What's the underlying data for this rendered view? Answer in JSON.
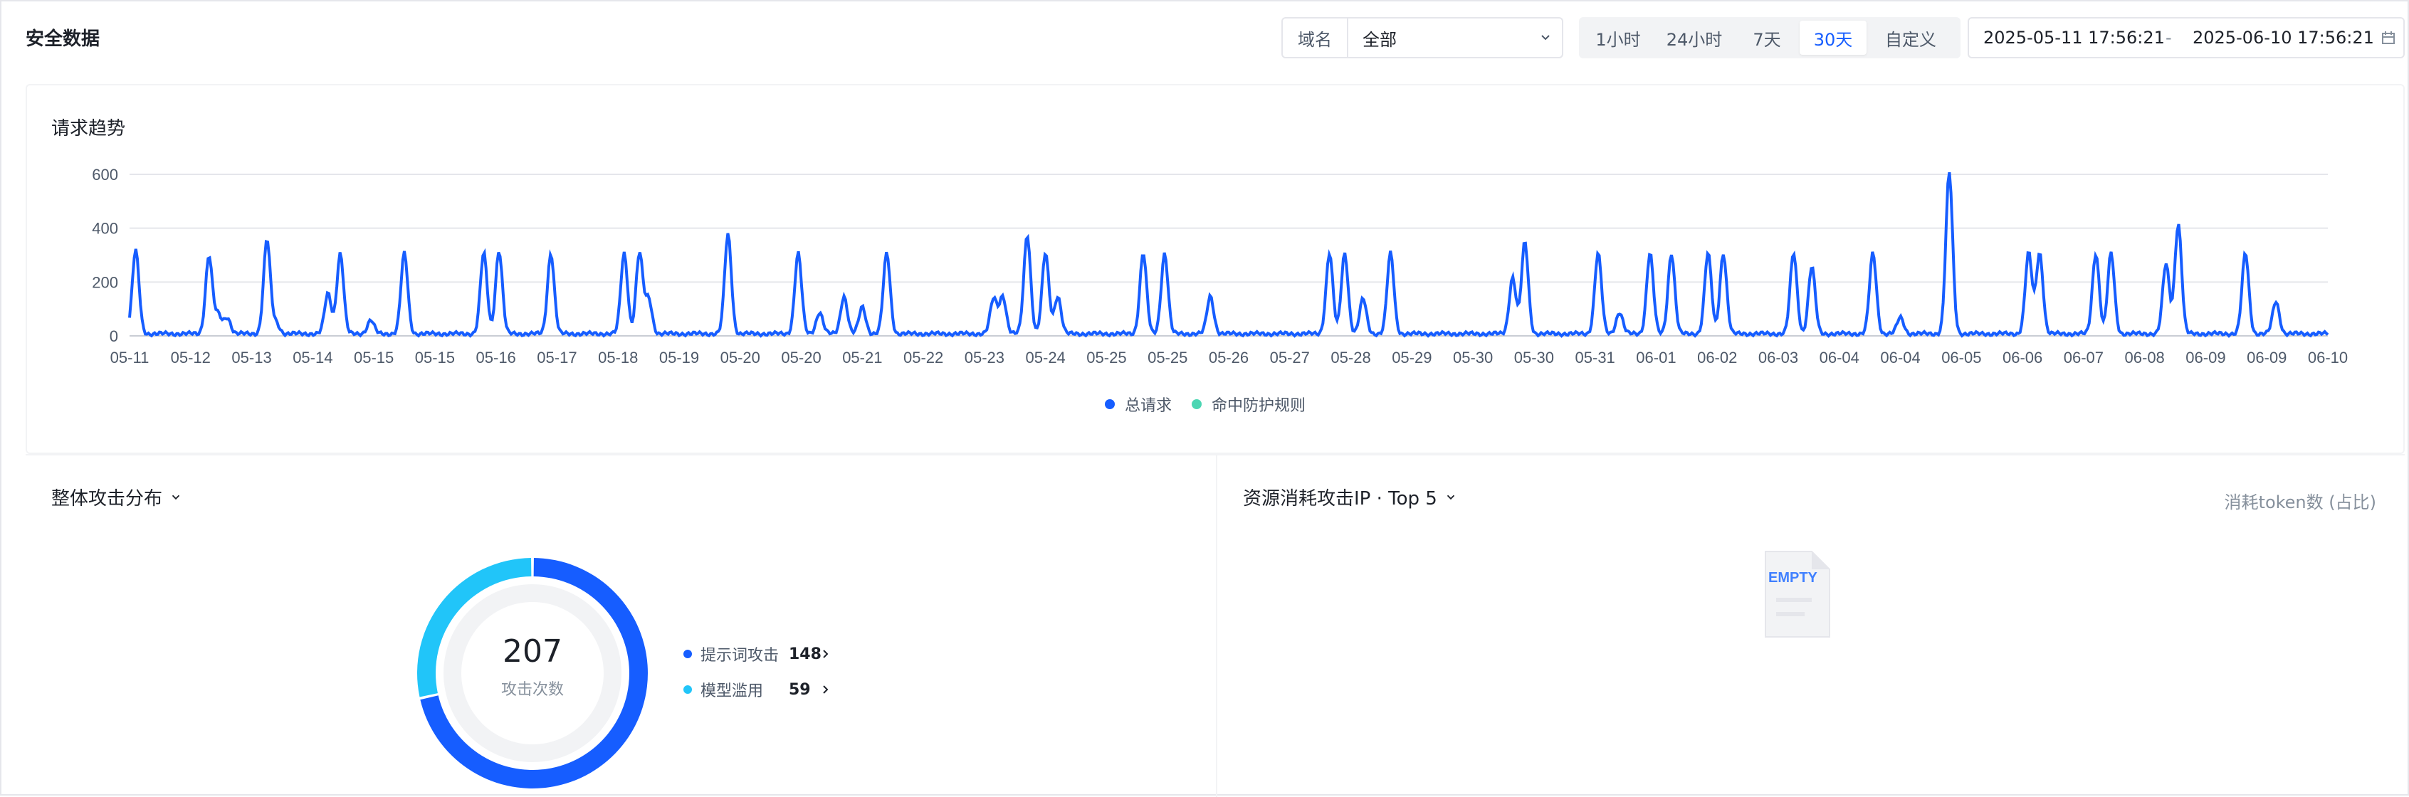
{
  "header": {
    "title": "安全数据",
    "domain_label": "域名",
    "domain_value": "全部",
    "time_options": [
      "1小时",
      "24小时",
      "7天",
      "30天",
      "自定义"
    ],
    "time_active": "30天",
    "range_start": "2025-05-11 17:56:21",
    "range_sep": "-",
    "range_end": "2025-06-10 17:56:21"
  },
  "trend": {
    "title": "请求趋势",
    "legend": [
      {
        "label": "总请求",
        "color": "#165dff"
      },
      {
        "label": "命中防护规则",
        "color": "#4cd6b3"
      }
    ]
  },
  "chart_data": {
    "type": "line",
    "ylim": [
      0,
      600
    ],
    "yticks": [
      0,
      200,
      400,
      600
    ],
    "grid": true,
    "legend_position": "bottom",
    "x_tick_labels": [
      "05-11",
      "05-12",
      "05-13",
      "05-14",
      "05-15",
      "05-15",
      "05-16",
      "05-17",
      "05-18",
      "05-19",
      "05-20",
      "05-20",
      "05-21",
      "05-22",
      "05-23",
      "05-24",
      "05-25",
      "05-25",
      "05-26",
      "05-27",
      "05-28",
      "05-29",
      "05-30",
      "05-30",
      "05-31",
      "06-01",
      "06-02",
      "06-03",
      "06-04",
      "06-04",
      "06-05",
      "06-06",
      "06-07",
      "06-08",
      "06-09",
      "06-09",
      "06-10"
    ],
    "series": [
      {
        "name": "总请求",
        "color": "#165dff",
        "peaks": [
          {
            "t": 0.1,
            "v": 310
          },
          {
            "t": 1.3,
            "v": 290
          },
          {
            "t": 1.45,
            "v": 70
          },
          {
            "t": 1.6,
            "v": 60
          },
          {
            "t": 2.25,
            "v": 350
          },
          {
            "t": 2.4,
            "v": 40
          },
          {
            "t": 3.25,
            "v": 150
          },
          {
            "t": 3.45,
            "v": 300
          },
          {
            "t": 3.95,
            "v": 50
          },
          {
            "t": 4.5,
            "v": 300
          },
          {
            "t": 5.8,
            "v": 300
          },
          {
            "t": 6.05,
            "v": 310
          },
          {
            "t": 6.9,
            "v": 300
          },
          {
            "t": 8.1,
            "v": 300
          },
          {
            "t": 8.35,
            "v": 300
          },
          {
            "t": 8.5,
            "v": 130
          },
          {
            "t": 9.8,
            "v": 370
          },
          {
            "t": 10.95,
            "v": 300
          },
          {
            "t": 11.3,
            "v": 80
          },
          {
            "t": 11.7,
            "v": 140
          },
          {
            "t": 12.0,
            "v": 100
          },
          {
            "t": 12.4,
            "v": 300
          },
          {
            "t": 14.15,
            "v": 130
          },
          {
            "t": 14.3,
            "v": 140
          },
          {
            "t": 14.7,
            "v": 370
          },
          {
            "t": 15.0,
            "v": 300
          },
          {
            "t": 15.2,
            "v": 140
          },
          {
            "t": 16.6,
            "v": 300
          },
          {
            "t": 16.95,
            "v": 300
          },
          {
            "t": 17.7,
            "v": 140
          },
          {
            "t": 19.65,
            "v": 300
          },
          {
            "t": 19.9,
            "v": 300
          },
          {
            "t": 20.2,
            "v": 130
          },
          {
            "t": 20.65,
            "v": 300
          },
          {
            "t": 22.65,
            "v": 210
          },
          {
            "t": 22.85,
            "v": 340
          },
          {
            "t": 24.05,
            "v": 300
          },
          {
            "t": 24.4,
            "v": 80
          },
          {
            "t": 24.9,
            "v": 300
          },
          {
            "t": 25.25,
            "v": 300
          },
          {
            "t": 25.85,
            "v": 300
          },
          {
            "t": 26.1,
            "v": 300
          },
          {
            "t": 27.25,
            "v": 300
          },
          {
            "t": 27.55,
            "v": 250
          },
          {
            "t": 28.55,
            "v": 300
          },
          {
            "t": 29.0,
            "v": 60
          },
          {
            "t": 29.8,
            "v": 600
          },
          {
            "t": 31.1,
            "v": 300
          },
          {
            "t": 31.28,
            "v": 300
          },
          {
            "t": 32.2,
            "v": 300
          },
          {
            "t": 32.45,
            "v": 300
          },
          {
            "t": 33.35,
            "v": 260
          },
          {
            "t": 33.55,
            "v": 410
          },
          {
            "t": 34.65,
            "v": 300
          },
          {
            "t": 35.15,
            "v": 120
          }
        ]
      },
      {
        "name": "命中防护规则",
        "color": "#4cd6b3",
        "values_note": ""
      }
    ]
  },
  "distribution": {
    "title": "整体攻击分布",
    "total": "207",
    "total_label": "攻击次数",
    "items": [
      {
        "name": "提示词攻击",
        "count": "148",
        "value": 148,
        "color": "#165dff"
      },
      {
        "name": "模型滥用",
        "count": "59",
        "value": 59,
        "color": "#21c5f9"
      }
    ]
  },
  "top_ip": {
    "title": "资源消耗攻击IP · Top 5",
    "note": "消耗token数 (占比)",
    "empty_text": "EMPTY"
  }
}
